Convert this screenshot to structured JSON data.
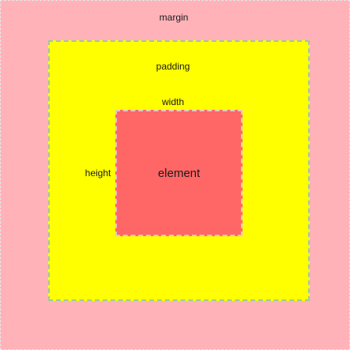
{
  "colors": {
    "margin": "#ffb3b8",
    "padding": "#ffff00",
    "element": "#ff6666"
  },
  "labels": {
    "margin": "margin",
    "padding": "padding",
    "width": "width",
    "height": "height",
    "element": "element"
  }
}
